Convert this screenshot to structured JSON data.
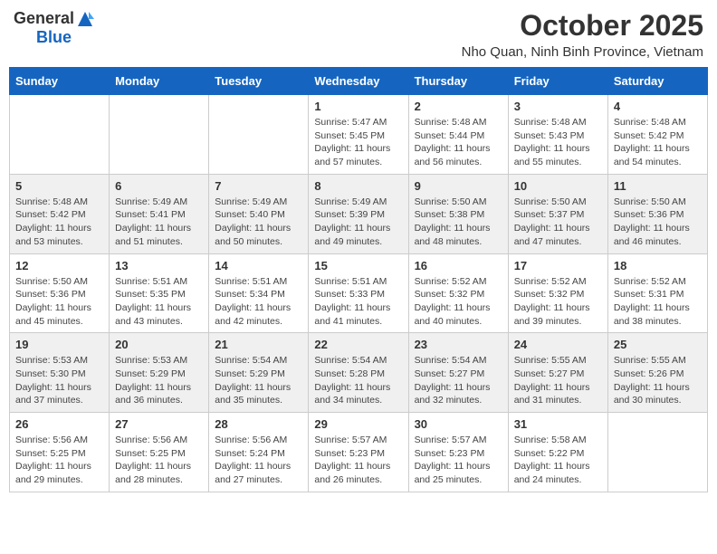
{
  "header": {
    "logo_general": "General",
    "logo_blue": "Blue",
    "month": "October 2025",
    "location": "Nho Quan, Ninh Binh Province, Vietnam"
  },
  "days_of_week": [
    "Sunday",
    "Monday",
    "Tuesday",
    "Wednesday",
    "Thursday",
    "Friday",
    "Saturday"
  ],
  "weeks": [
    [
      {
        "day": "",
        "info": ""
      },
      {
        "day": "",
        "info": ""
      },
      {
        "day": "",
        "info": ""
      },
      {
        "day": "1",
        "info": "Sunrise: 5:47 AM\nSunset: 5:45 PM\nDaylight: 11 hours\nand 57 minutes."
      },
      {
        "day": "2",
        "info": "Sunrise: 5:48 AM\nSunset: 5:44 PM\nDaylight: 11 hours\nand 56 minutes."
      },
      {
        "day": "3",
        "info": "Sunrise: 5:48 AM\nSunset: 5:43 PM\nDaylight: 11 hours\nand 55 minutes."
      },
      {
        "day": "4",
        "info": "Sunrise: 5:48 AM\nSunset: 5:42 PM\nDaylight: 11 hours\nand 54 minutes."
      }
    ],
    [
      {
        "day": "5",
        "info": "Sunrise: 5:48 AM\nSunset: 5:42 PM\nDaylight: 11 hours\nand 53 minutes."
      },
      {
        "day": "6",
        "info": "Sunrise: 5:49 AM\nSunset: 5:41 PM\nDaylight: 11 hours\nand 51 minutes."
      },
      {
        "day": "7",
        "info": "Sunrise: 5:49 AM\nSunset: 5:40 PM\nDaylight: 11 hours\nand 50 minutes."
      },
      {
        "day": "8",
        "info": "Sunrise: 5:49 AM\nSunset: 5:39 PM\nDaylight: 11 hours\nand 49 minutes."
      },
      {
        "day": "9",
        "info": "Sunrise: 5:50 AM\nSunset: 5:38 PM\nDaylight: 11 hours\nand 48 minutes."
      },
      {
        "day": "10",
        "info": "Sunrise: 5:50 AM\nSunset: 5:37 PM\nDaylight: 11 hours\nand 47 minutes."
      },
      {
        "day": "11",
        "info": "Sunrise: 5:50 AM\nSunset: 5:36 PM\nDaylight: 11 hours\nand 46 minutes."
      }
    ],
    [
      {
        "day": "12",
        "info": "Sunrise: 5:50 AM\nSunset: 5:36 PM\nDaylight: 11 hours\nand 45 minutes."
      },
      {
        "day": "13",
        "info": "Sunrise: 5:51 AM\nSunset: 5:35 PM\nDaylight: 11 hours\nand 43 minutes."
      },
      {
        "day": "14",
        "info": "Sunrise: 5:51 AM\nSunset: 5:34 PM\nDaylight: 11 hours\nand 42 minutes."
      },
      {
        "day": "15",
        "info": "Sunrise: 5:51 AM\nSunset: 5:33 PM\nDaylight: 11 hours\nand 41 minutes."
      },
      {
        "day": "16",
        "info": "Sunrise: 5:52 AM\nSunset: 5:32 PM\nDaylight: 11 hours\nand 40 minutes."
      },
      {
        "day": "17",
        "info": "Sunrise: 5:52 AM\nSunset: 5:32 PM\nDaylight: 11 hours\nand 39 minutes."
      },
      {
        "day": "18",
        "info": "Sunrise: 5:52 AM\nSunset: 5:31 PM\nDaylight: 11 hours\nand 38 minutes."
      }
    ],
    [
      {
        "day": "19",
        "info": "Sunrise: 5:53 AM\nSunset: 5:30 PM\nDaylight: 11 hours\nand 37 minutes."
      },
      {
        "day": "20",
        "info": "Sunrise: 5:53 AM\nSunset: 5:29 PM\nDaylight: 11 hours\nand 36 minutes."
      },
      {
        "day": "21",
        "info": "Sunrise: 5:54 AM\nSunset: 5:29 PM\nDaylight: 11 hours\nand 35 minutes."
      },
      {
        "day": "22",
        "info": "Sunrise: 5:54 AM\nSunset: 5:28 PM\nDaylight: 11 hours\nand 34 minutes."
      },
      {
        "day": "23",
        "info": "Sunrise: 5:54 AM\nSunset: 5:27 PM\nDaylight: 11 hours\nand 32 minutes."
      },
      {
        "day": "24",
        "info": "Sunrise: 5:55 AM\nSunset: 5:27 PM\nDaylight: 11 hours\nand 31 minutes."
      },
      {
        "day": "25",
        "info": "Sunrise: 5:55 AM\nSunset: 5:26 PM\nDaylight: 11 hours\nand 30 minutes."
      }
    ],
    [
      {
        "day": "26",
        "info": "Sunrise: 5:56 AM\nSunset: 5:25 PM\nDaylight: 11 hours\nand 29 minutes."
      },
      {
        "day": "27",
        "info": "Sunrise: 5:56 AM\nSunset: 5:25 PM\nDaylight: 11 hours\nand 28 minutes."
      },
      {
        "day": "28",
        "info": "Sunrise: 5:56 AM\nSunset: 5:24 PM\nDaylight: 11 hours\nand 27 minutes."
      },
      {
        "day": "29",
        "info": "Sunrise: 5:57 AM\nSunset: 5:23 PM\nDaylight: 11 hours\nand 26 minutes."
      },
      {
        "day": "30",
        "info": "Sunrise: 5:57 AM\nSunset: 5:23 PM\nDaylight: 11 hours\nand 25 minutes."
      },
      {
        "day": "31",
        "info": "Sunrise: 5:58 AM\nSunset: 5:22 PM\nDaylight: 11 hours\nand 24 minutes."
      },
      {
        "day": "",
        "info": ""
      }
    ]
  ]
}
